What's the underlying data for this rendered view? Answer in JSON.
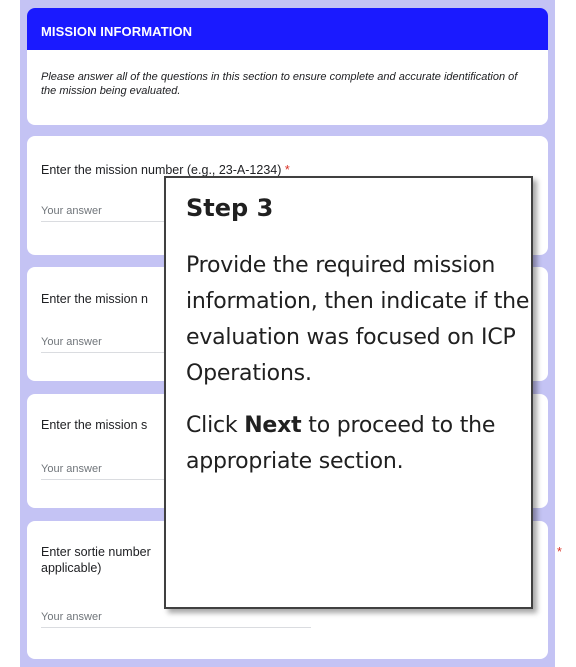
{
  "section": {
    "title": "MISSION INFORMATION",
    "description": "Please answer all of the questions in this section to ensure complete and accurate identification of the mission being evaluated."
  },
  "questions": [
    {
      "label": "Enter the mission number (e.g., 23-A-1234)",
      "required_mark": "*",
      "placeholder": "Your answer"
    },
    {
      "label": "Enter the mission n",
      "placeholder": "Your answer"
    },
    {
      "label": "Enter the mission s",
      "placeholder": "Your answer"
    },
    {
      "label": "Enter sortie number",
      "label_line2": "applicable)",
      "required_mark": "*",
      "placeholder": "Your answer"
    }
  ],
  "callout": {
    "title": "Step 3",
    "paragraph1": "Provide the required mission information, then indicate if the evaluation was focused on ICP Operations.",
    "paragraph2_prefix": "Click ",
    "paragraph2_bold": "Next",
    "paragraph2_suffix": " to proceed to the appropriate section."
  },
  "colors": {
    "header_bg": "#1a1aff",
    "page_bg": "#c4c3f4",
    "required": "#d93025"
  }
}
